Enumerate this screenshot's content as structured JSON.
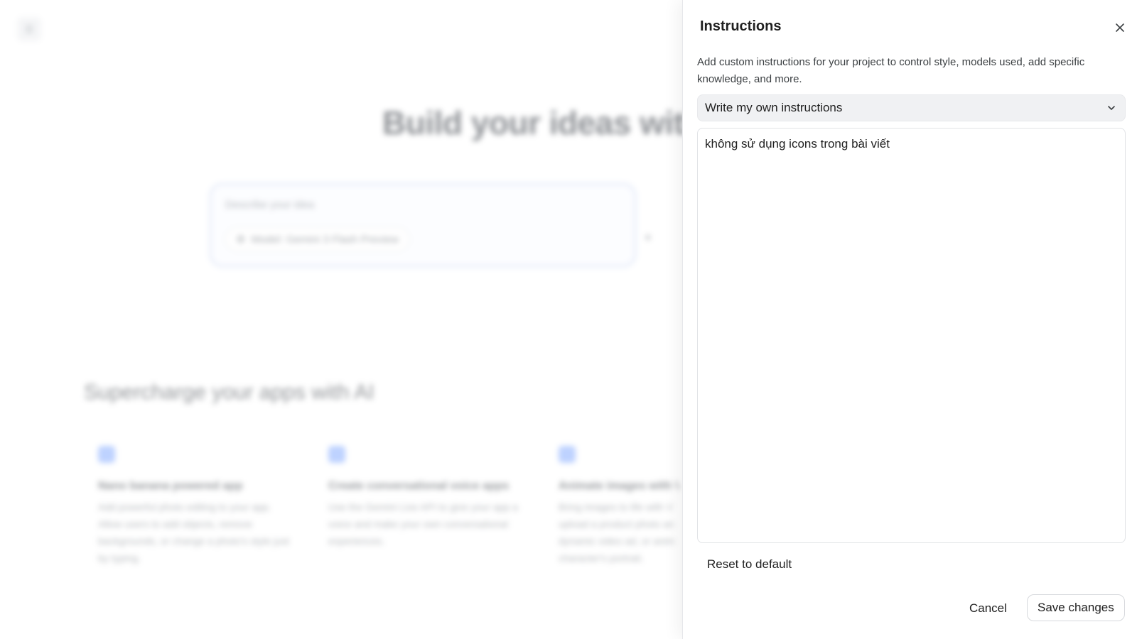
{
  "background": {
    "toggle_icon": "sidebar-toggle-icon",
    "hero_title": "Build your ideas with Ge",
    "prompt_placeholder": "Describe your idea",
    "model_chip_label": "Model: Gemini 3 Flash Preview",
    "section_title": "Supercharge your apps with AI",
    "cards": [
      {
        "title": "Nano banana powered app",
        "description": "Add powerful photo editing to your app. Allow users to add objects, remove backgrounds, or change a photo's style just by typing."
      },
      {
        "title": "Create conversational voice apps",
        "description": "Use the Gemini Live API to give your app a voice and make your own conversational experiences."
      },
      {
        "title": "Animate images with V",
        "description": "Bring images to life with V upload a product photo an dynamic video ad, or anim character's portrait."
      }
    ]
  },
  "panel": {
    "title": "Instructions",
    "close_icon": "close-icon",
    "description": "Add custom instructions for your project to control style, models used, add specific knowledge, and more.",
    "mode_select": {
      "selected": "Write my own instructions",
      "icon": "chevron-down-icon"
    },
    "instructions_text": "không sử dụng icons trong bài viết",
    "reset_label": "Reset to default",
    "cancel_label": "Cancel",
    "save_label": "Save changes"
  },
  "colors": {
    "panel_bg": "#ffffff",
    "select_bg": "#f0f1f3",
    "border": "#e1e3e6",
    "text": "#1f1f1f"
  }
}
